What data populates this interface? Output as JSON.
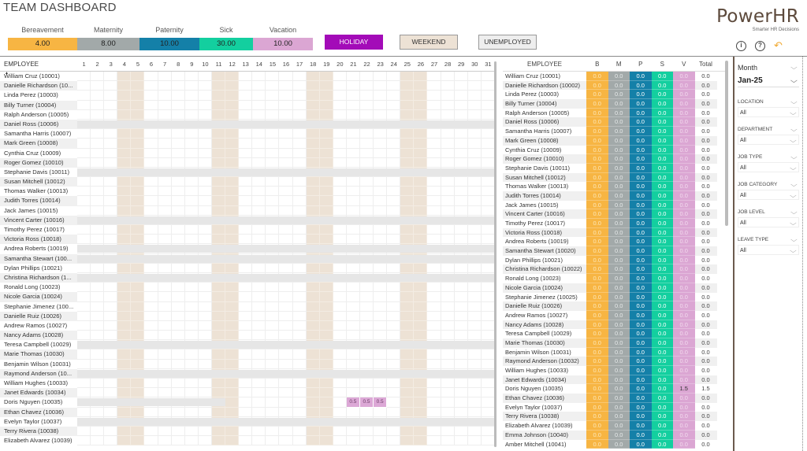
{
  "title": "TEAM DASHBOARD",
  "brand": {
    "name": "PowerHR",
    "tagline": "Smarter HR Decisions"
  },
  "header_icons": [
    {
      "name": "info-icon",
      "glyph": "i"
    },
    {
      "name": "help-icon",
      "glyph": "?"
    },
    {
      "name": "undo-icon",
      "glyph": "↶"
    }
  ],
  "leave_balances": [
    {
      "label": "Bereavement",
      "value": "4.00",
      "color": "#f7b543"
    },
    {
      "label": "Maternity",
      "value": "8.00",
      "color": "#a2a9a9"
    },
    {
      "label": "Paternity",
      "value": "10.00",
      "color": "#1480a8"
    },
    {
      "label": "Sick",
      "value": "30.00",
      "color": "#13cf9f"
    },
    {
      "label": "Vacation",
      "value": "10.00",
      "color": "#dba6d3"
    }
  ],
  "key_buttons": [
    {
      "label": "HOLIDAY",
      "color": "#a30bb8",
      "text_color": "#ffffff"
    },
    {
      "label": "WEEKEND",
      "color": "#ede2d5",
      "text_color": "#333333"
    },
    {
      "label": "UNEMPLOYED",
      "color": "#eeeeee",
      "text_color": "#333333"
    }
  ],
  "calendar": {
    "employee_header": "EMPLOYEE",
    "days": [
      "1",
      "2",
      "3",
      "4",
      "5",
      "6",
      "7",
      "8",
      "9",
      "10",
      "11",
      "12",
      "13",
      "14",
      "15",
      "16",
      "17",
      "18",
      "19",
      "20",
      "21",
      "22",
      "23",
      "24",
      "25",
      "26",
      "27",
      "28",
      "29",
      "30",
      "31"
    ],
    "weekend_days": [
      4,
      5,
      11,
      12,
      18,
      19,
      25,
      26
    ],
    "rows": [
      {
        "name": "William Cruz (10001)"
      },
      {
        "name": "Danielle Richardson (10..."
      },
      {
        "name": "Linda Perez (10003)"
      },
      {
        "name": "Billy Turner (10004)"
      },
      {
        "name": "Ralph Anderson (10005)"
      },
      {
        "name": "Daniel Ross (10006)",
        "unemployed_until_day": 31
      },
      {
        "name": "Samantha Harris (10007)"
      },
      {
        "name": "Mark Green (10008)"
      },
      {
        "name": "Cynthia Cruz (10009)"
      },
      {
        "name": "Roger Gomez (10010)"
      },
      {
        "name": "Stephanie Davis (10011)",
        "unemployed_until_day": 31
      },
      {
        "name": "Susan Mitchell (10012)"
      },
      {
        "name": "Thomas Walker (10013)"
      },
      {
        "name": "Judith Torres (10014)"
      },
      {
        "name": "Jack James (10015)"
      },
      {
        "name": "Vincent Carter (10016)",
        "unemployed_until_day": 31
      },
      {
        "name": "Timothy Perez (10017)"
      },
      {
        "name": "Victoria Ross (10018)"
      },
      {
        "name": "Andrea Roberts (10019)",
        "unemployed_until_day": 31
      },
      {
        "name": "Samantha Stewart (100...",
        "unemployed_until_day": 31
      },
      {
        "name": "Dylan Phillips (10021)"
      },
      {
        "name": "Christina Richardson (1...",
        "unemployed_until_day": 31
      },
      {
        "name": "Ronald Long (10023)"
      },
      {
        "name": "Nicole Garcia (10024)"
      },
      {
        "name": "Stephanie Jimenez (100..."
      },
      {
        "name": "Danielle Ruiz (10026)"
      },
      {
        "name": "Andrew Ramos (10027)"
      },
      {
        "name": "Nancy Adams (10028)"
      },
      {
        "name": "Teresa Campbell (10029)",
        "unemployed_until_day": 31
      },
      {
        "name": "Marie Thomas (10030)"
      },
      {
        "name": "Benjamin Wilson (10031)"
      },
      {
        "name": "Raymond Anderson (10...",
        "unemployed_until_day": 31
      },
      {
        "name": "William Hughes (10033)"
      },
      {
        "name": "Janet Edwards (10034)"
      },
      {
        "name": "Doris Nguyen (10035)",
        "unemployed_until_day": 11,
        "leave": {
          "21": "0.5",
          "22": "0.5",
          "23": "0.5"
        }
      },
      {
        "name": "Ethan Chavez (10036)"
      },
      {
        "name": "Evelyn Taylor (10037)",
        "unemployed_until_day": 31
      },
      {
        "name": "Terry Rivera (10038)"
      },
      {
        "name": "Elizabeth Alvarez (10039)"
      }
    ]
  },
  "summary": {
    "headers": {
      "employee": "EMPLOYEE",
      "b": "B",
      "m": "M",
      "p": "P",
      "s": "S",
      "v": "V",
      "total": "Total"
    },
    "rows": [
      {
        "name": "William Cruz (10001)",
        "b": "0.0",
        "m": "0.0",
        "p": "0.0",
        "s": "0.0",
        "v": "0.0",
        "total": "0.0"
      },
      {
        "name": "Danielle Richardson (10002)",
        "b": "0.0",
        "m": "0.0",
        "p": "0.0",
        "s": "0.0",
        "v": "0.0",
        "total": "0.0"
      },
      {
        "name": "Linda Perez (10003)",
        "b": "0.0",
        "m": "0.0",
        "p": "0.0",
        "s": "0.0",
        "v": "0.0",
        "total": "0.0"
      },
      {
        "name": "Billy Turner (10004)",
        "b": "0.0",
        "m": "0.0",
        "p": "0.0",
        "s": "0.0",
        "v": "0.0",
        "total": "0.0"
      },
      {
        "name": "Ralph Anderson (10005)",
        "b": "0.0",
        "m": "0.0",
        "p": "0.0",
        "s": "0.0",
        "v": "0.0",
        "total": "0.0"
      },
      {
        "name": "Daniel Ross (10006)",
        "b": "0.0",
        "m": "0.0",
        "p": "0.0",
        "s": "0.0",
        "v": "0.0",
        "total": "0.0"
      },
      {
        "name": "Samantha Harris (10007)",
        "b": "0.0",
        "m": "0.0",
        "p": "0.0",
        "s": "0.0",
        "v": "0.0",
        "total": "0.0"
      },
      {
        "name": "Mark Green (10008)",
        "b": "0.0",
        "m": "0.0",
        "p": "0.0",
        "s": "0.0",
        "v": "0.0",
        "total": "0.0"
      },
      {
        "name": "Cynthia Cruz (10009)",
        "b": "0.0",
        "m": "0.0",
        "p": "0.0",
        "s": "0.0",
        "v": "0.0",
        "total": "0.0"
      },
      {
        "name": "Roger Gomez (10010)",
        "b": "0.0",
        "m": "0.0",
        "p": "0.0",
        "s": "0.0",
        "v": "0.0",
        "total": "0.0"
      },
      {
        "name": "Stephanie Davis (10011)",
        "b": "0.0",
        "m": "0.0",
        "p": "0.0",
        "s": "0.0",
        "v": "0.0",
        "total": "0.0"
      },
      {
        "name": "Susan Mitchell (10012)",
        "b": "0.0",
        "m": "0.0",
        "p": "0.0",
        "s": "0.0",
        "v": "0.0",
        "total": "0.0"
      },
      {
        "name": "Thomas Walker (10013)",
        "b": "0.0",
        "m": "0.0",
        "p": "0.0",
        "s": "0.0",
        "v": "0.0",
        "total": "0.0"
      },
      {
        "name": "Judith Torres (10014)",
        "b": "0.0",
        "m": "0.0",
        "p": "0.0",
        "s": "0.0",
        "v": "0.0",
        "total": "0.0"
      },
      {
        "name": "Jack James (10015)",
        "b": "0.0",
        "m": "0.0",
        "p": "0.0",
        "s": "0.0",
        "v": "0.0",
        "total": "0.0"
      },
      {
        "name": "Vincent Carter (10016)",
        "b": "0.0",
        "m": "0.0",
        "p": "0.0",
        "s": "0.0",
        "v": "0.0",
        "total": "0.0"
      },
      {
        "name": "Timothy Perez (10017)",
        "b": "0.0",
        "m": "0.0",
        "p": "0.0",
        "s": "0.0",
        "v": "0.0",
        "total": "0.0"
      },
      {
        "name": "Victoria Ross (10018)",
        "b": "0.0",
        "m": "0.0",
        "p": "0.0",
        "s": "0.0",
        "v": "0.0",
        "total": "0.0"
      },
      {
        "name": "Andrea Roberts (10019)",
        "b": "0.0",
        "m": "0.0",
        "p": "0.0",
        "s": "0.0",
        "v": "0.0",
        "total": "0.0"
      },
      {
        "name": "Samantha Stewart (10020)",
        "b": "0.0",
        "m": "0.0",
        "p": "0.0",
        "s": "0.0",
        "v": "0.0",
        "total": "0.0"
      },
      {
        "name": "Dylan Phillips (10021)",
        "b": "0.0",
        "m": "0.0",
        "p": "0.0",
        "s": "0.0",
        "v": "0.0",
        "total": "0.0"
      },
      {
        "name": "Christina Richardson (10022)",
        "b": "0.0",
        "m": "0.0",
        "p": "0.0",
        "s": "0.0",
        "v": "0.0",
        "total": "0.0"
      },
      {
        "name": "Ronald Long (10023)",
        "b": "0.0",
        "m": "0.0",
        "p": "0.0",
        "s": "0.0",
        "v": "0.0",
        "total": "0.0"
      },
      {
        "name": "Nicole Garcia (10024)",
        "b": "0.0",
        "m": "0.0",
        "p": "0.0",
        "s": "0.0",
        "v": "0.0",
        "total": "0.0"
      },
      {
        "name": "Stephanie Jimenez (10025)",
        "b": "0.0",
        "m": "0.0",
        "p": "0.0",
        "s": "0.0",
        "v": "0.0",
        "total": "0.0"
      },
      {
        "name": "Danielle Ruiz (10026)",
        "b": "0.0",
        "m": "0.0",
        "p": "0.0",
        "s": "0.0",
        "v": "0.0",
        "total": "0.0"
      },
      {
        "name": "Andrew Ramos (10027)",
        "b": "0.0",
        "m": "0.0",
        "p": "0.0",
        "s": "0.0",
        "v": "0.0",
        "total": "0.0"
      },
      {
        "name": "Nancy Adams (10028)",
        "b": "0.0",
        "m": "0.0",
        "p": "0.0",
        "s": "0.0",
        "v": "0.0",
        "total": "0.0"
      },
      {
        "name": "Teresa Campbell (10029)",
        "b": "0.0",
        "m": "0.0",
        "p": "0.0",
        "s": "0.0",
        "v": "0.0",
        "total": "0.0"
      },
      {
        "name": "Marie Thomas (10030)",
        "b": "0.0",
        "m": "0.0",
        "p": "0.0",
        "s": "0.0",
        "v": "0.0",
        "total": "0.0"
      },
      {
        "name": "Benjamin Wilson (10031)",
        "b": "0.0",
        "m": "0.0",
        "p": "0.0",
        "s": "0.0",
        "v": "0.0",
        "total": "0.0"
      },
      {
        "name": "Raymond Anderson (10032)",
        "b": "0.0",
        "m": "0.0",
        "p": "0.0",
        "s": "0.0",
        "v": "0.0",
        "total": "0.0"
      },
      {
        "name": "William Hughes (10033)",
        "b": "0.0",
        "m": "0.0",
        "p": "0.0",
        "s": "0.0",
        "v": "0.0",
        "total": "0.0"
      },
      {
        "name": "Janet Edwards (10034)",
        "b": "0.0",
        "m": "0.0",
        "p": "0.0",
        "s": "0.0",
        "v": "0.0",
        "total": "0.0"
      },
      {
        "name": "Doris Nguyen (10035)",
        "b": "0.0",
        "m": "0.0",
        "p": "0.0",
        "s": "0.0",
        "v": "1.5",
        "total": "1.5"
      },
      {
        "name": "Ethan Chavez (10036)",
        "b": "0.0",
        "m": "0.0",
        "p": "0.0",
        "s": "0.0",
        "v": "0.0",
        "total": "0.0"
      },
      {
        "name": "Evelyn Taylor (10037)",
        "b": "0.0",
        "m": "0.0",
        "p": "0.0",
        "s": "0.0",
        "v": "0.0",
        "total": "0.0"
      },
      {
        "name": "Terry Rivera (10038)",
        "b": "0.0",
        "m": "0.0",
        "p": "0.0",
        "s": "0.0",
        "v": "0.0",
        "total": "0.0"
      },
      {
        "name": "Elizabeth Alvarez (10039)",
        "b": "0.0",
        "m": "0.0",
        "p": "0.0",
        "s": "0.0",
        "v": "0.0",
        "total": "0.0"
      },
      {
        "name": "Emma Johnson (10040)",
        "b": "0.0",
        "m": "0.0",
        "p": "0.0",
        "s": "0.0",
        "v": "0.0",
        "total": "0.0"
      },
      {
        "name": "Amber Mitchell (10041)",
        "b": "0.0",
        "m": "0.0",
        "p": "0.0",
        "s": "0.0",
        "v": "0.0",
        "total": "0.0"
      }
    ]
  },
  "filters": {
    "month": {
      "title": "Month",
      "value": "Jan-25"
    },
    "slicers": [
      {
        "label": "LOCATION",
        "value": "All"
      },
      {
        "label": "DEPARTMENT",
        "value": "All"
      },
      {
        "label": "JOB TYPE",
        "value": "All"
      },
      {
        "label": "JOB CATEGORY",
        "value": "All"
      },
      {
        "label": "JOB LEVEL",
        "value": "All"
      },
      {
        "label": "LEAVE TYPE",
        "value": "All"
      }
    ],
    "chevron": "⌵"
  }
}
